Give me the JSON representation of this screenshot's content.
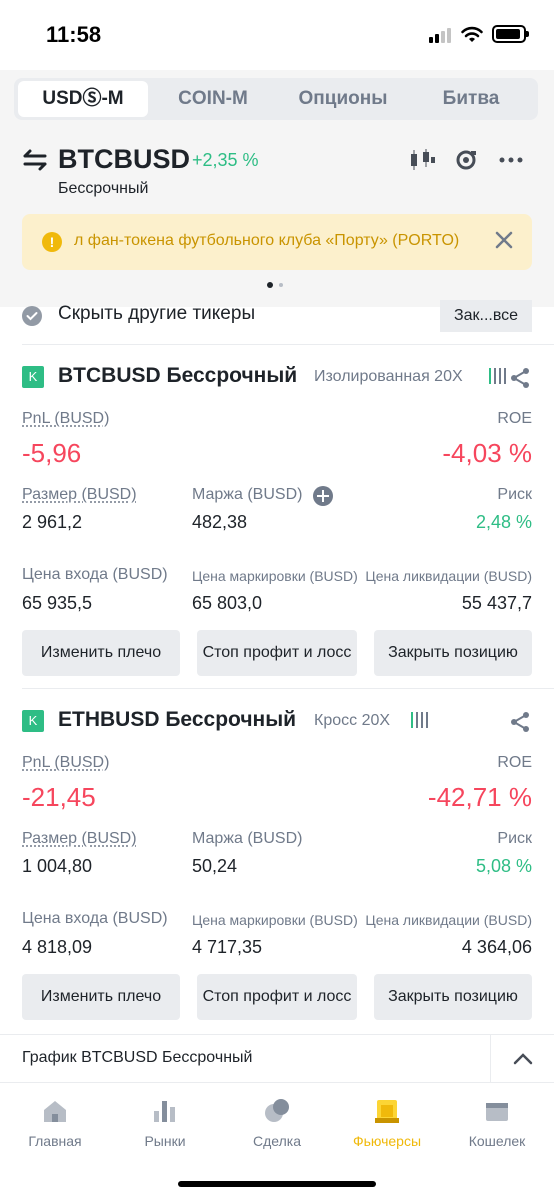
{
  "status_bar": {
    "time": "11:58"
  },
  "tabs": [
    {
      "label": "USDⓈ-M",
      "active": true
    },
    {
      "label": "COIN-M",
      "active": false
    },
    {
      "label": "Опционы",
      "active": false
    },
    {
      "label": "Битва",
      "active": false
    }
  ],
  "header": {
    "symbol": "BTCBUSD",
    "change": "+2,35 %",
    "subtitle": "Бессрочный",
    "icons": [
      "candlestick-icon",
      "camera-icon",
      "more-icon"
    ]
  },
  "banner": {
    "text": "л фан-токена футбольного клуба «Порту» (PORTO)"
  },
  "positions_header": {
    "hide_label": "Скрыть другие тикеры",
    "close_all": "Зак...все"
  },
  "positions": [
    {
      "badge": "K",
      "title": "BTCBUSD Бессрочный",
      "mode": "Изолированная 20X",
      "pnl_label": "PnL (BUSD)",
      "pnl": "-5,96",
      "roe_label": "ROE",
      "roe": "-4,03 %",
      "size_label": "Размер (BUSD)",
      "size": "2 961,2",
      "margin_label": "Маржа (BUSD)",
      "margin": "482,38",
      "risk_label": "Риск",
      "risk": "2,48 %",
      "entry_label": "Цена входа (BUSD)",
      "entry": "65 935,5",
      "mark_label": "Цена маркировки (BUSD)",
      "mark": "65 803,0",
      "liq_label": "Цена ликвидации (BUSD)",
      "liq": "55 437,7",
      "btn_leverage": "Изменить плечо",
      "btn_tpsl": "Стоп профит и лосс",
      "btn_close": "Закрыть позицию"
    },
    {
      "badge": "K",
      "title": "ETHBUSD Бессрочный",
      "mode": "Кросс 20X",
      "pnl_label": "PnL (BUSD)",
      "pnl": "-21,45",
      "roe_label": "ROE",
      "roe": "-42,71 %",
      "size_label": "Размер (BUSD)",
      "size": "1 004,80",
      "margin_label": "Маржа (BUSD)",
      "margin": "50,24",
      "risk_label": "Риск",
      "risk": "5,08 %",
      "entry_label": "Цена входа (BUSD)",
      "entry": "4 818,09",
      "mark_label": "Цена маркировки (BUSD)",
      "mark": "4 717,35",
      "liq_label": "Цена ликвидации (BUSD)",
      "liq": "4 364,06",
      "btn_leverage": "Изменить плечо",
      "btn_tpsl": "Стоп профит и лосс",
      "btn_close": "Закрыть позицию"
    }
  ],
  "chart_bar": {
    "label": "График BTCBUSD Бессрочный"
  },
  "bottom_nav": [
    {
      "label": "Главная",
      "icon": "home-icon",
      "active": false
    },
    {
      "label": "Рынки",
      "icon": "markets-icon",
      "active": false
    },
    {
      "label": "Сделка",
      "icon": "trade-icon",
      "active": false
    },
    {
      "label": "Фьючерсы",
      "icon": "futures-icon",
      "active": true
    },
    {
      "label": "Кошелек",
      "icon": "wallet-icon",
      "active": false
    }
  ],
  "colors": {
    "accent": "#f0b90b",
    "positive": "#2ebd85",
    "negative": "#f6465d",
    "banner_bg": "#fcf0cc"
  }
}
